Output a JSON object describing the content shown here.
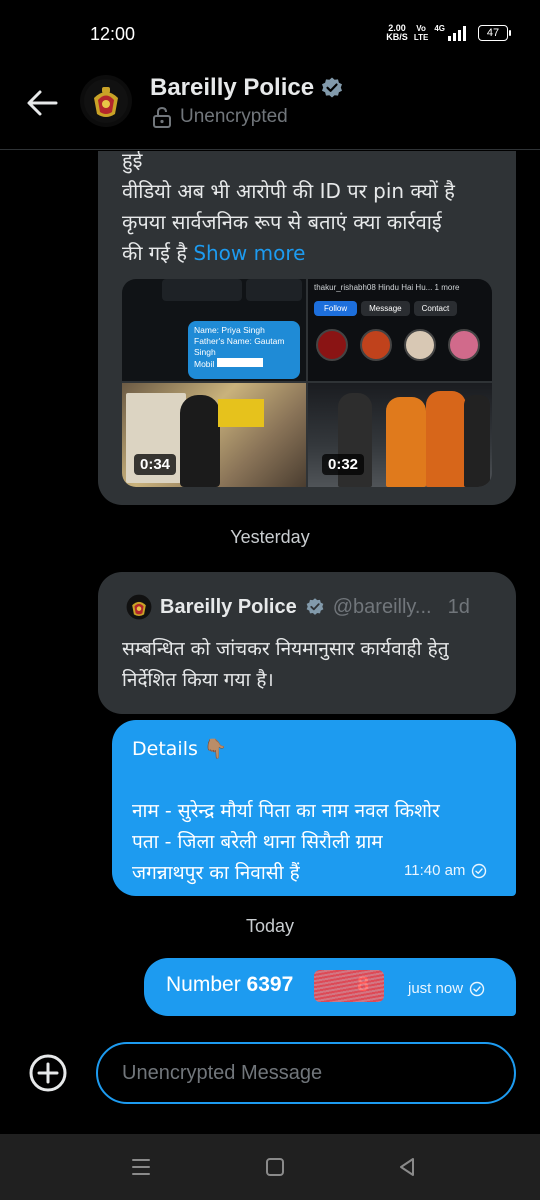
{
  "status": {
    "time": "12:00",
    "net_speed": "2.00",
    "net_unit": "KB/S",
    "volte_top": "Vo",
    "volte_bottom": "LTE",
    "network": "4G",
    "battery": "47"
  },
  "header": {
    "name": "Bareilly Police",
    "subtitle": "Unencrypted"
  },
  "messages": [
    {
      "text_main": "हुई\nवीडियो अब भी आरोपी की ID पर pin क्यों है\nकृपया सार्वजनिक रूप से बताएं क्या कार्रवाई\nकी गई है ",
      "show_more": "Show more",
      "media": [
        {
          "label": "screenshot-chat",
          "caption_name": "Name: Priya Singh",
          "caption_father": "Father's Name: Gautam Singh",
          "caption_mob": "Mobil"
        },
        {
          "label": "screenshot-profile",
          "handle": "thakur_rishabh08",
          "title": "Hindu Hai Hu... 1 more",
          "btn_follow": "Follow",
          "btn_message": "Message",
          "btn_contact": "Contact"
        },
        {
          "label": "video-1",
          "duration": "0:34"
        },
        {
          "label": "video-2",
          "duration": "0:32"
        }
      ]
    }
  ],
  "separators": {
    "yesterday": "Yesterday",
    "today": "Today"
  },
  "quote": {
    "name": "Bareilly Police",
    "handle": "@bareilly...",
    "age": "1d",
    "text": "सम्बन्धित को जांचकर नियमानुसार कार्यवाही हेतु निर्देशित किया गया है।"
  },
  "details_message": {
    "text": "Details 👇🏽\n\nनाम - सुरेन्द्र मौर्या पिता का नाम नवल किशोर\nपता - जिला बरेली थाना सिरौली ग्राम\nजगन्नाथपुर का निवासी हैं",
    "time": "11:40 am"
  },
  "number_message": {
    "label": "Number ",
    "value_start": "6397",
    "value_end": "8",
    "time": "just now"
  },
  "composer": {
    "placeholder": "Unencrypted Message"
  },
  "colors": {
    "accent": "#1d9bf0",
    "bubble_in": "#2f3336",
    "muted": "#71767b"
  }
}
